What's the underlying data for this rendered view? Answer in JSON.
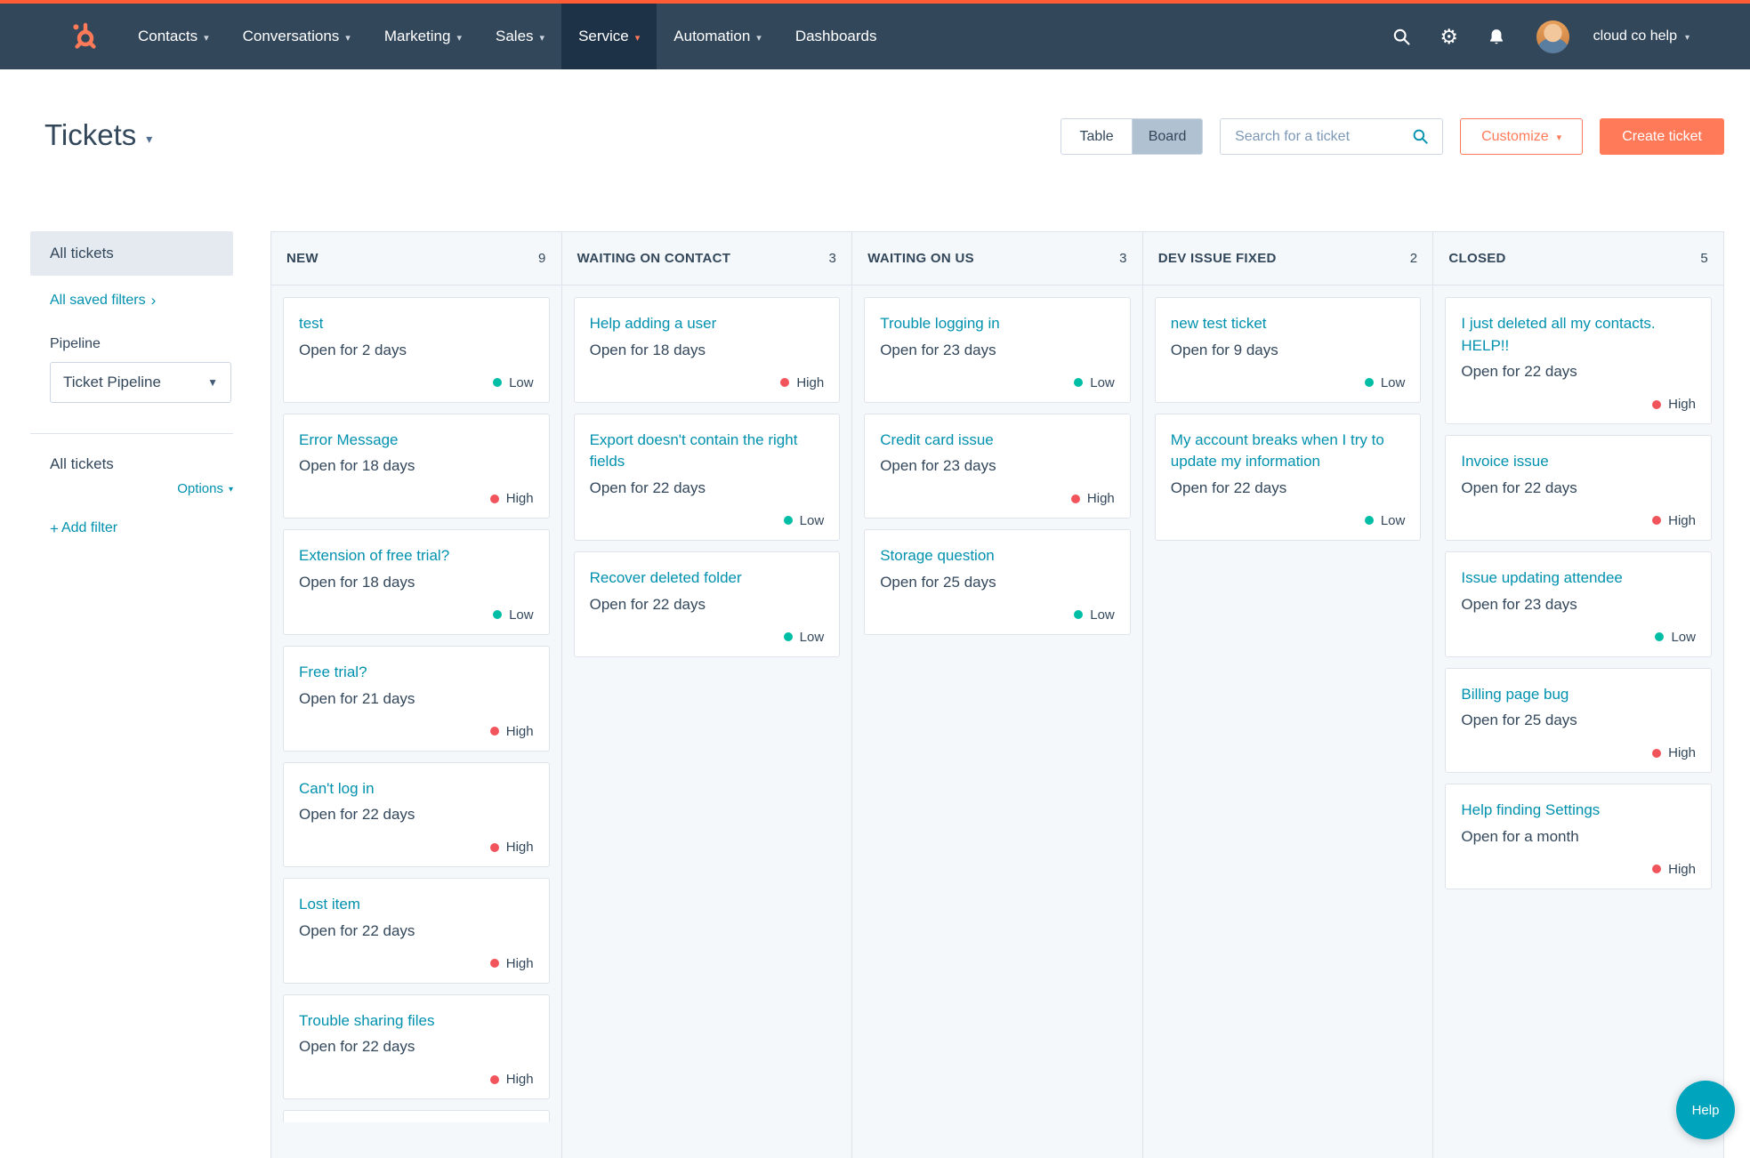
{
  "topbar": {
    "nav": [
      {
        "label": "Contacts",
        "caret": true,
        "active": false
      },
      {
        "label": "Conversations",
        "caret": true,
        "active": false
      },
      {
        "label": "Marketing",
        "caret": true,
        "active": false
      },
      {
        "label": "Sales",
        "caret": true,
        "active": false
      },
      {
        "label": "Service",
        "caret": true,
        "active": true
      },
      {
        "label": "Automation",
        "caret": true,
        "active": false
      },
      {
        "label": "Dashboards",
        "caret": false,
        "active": false
      }
    ],
    "account_name": "cloud co help"
  },
  "header": {
    "title": "Tickets",
    "view_table": "Table",
    "view_board": "Board",
    "selected_view": "Board",
    "search_placeholder": "Search for a ticket",
    "customize_label": "Customize",
    "create_label": "Create ticket"
  },
  "sidebar": {
    "all_tickets": "All tickets",
    "saved_filters": "All saved filters",
    "pipeline_label": "Pipeline",
    "pipeline_value": "Ticket Pipeline",
    "filter_header": "All tickets",
    "options_label": "Options",
    "add_filter_label": "Add filter"
  },
  "board": {
    "columns": [
      {
        "name": "NEW",
        "count": 9,
        "partial": true,
        "cards": [
          {
            "title": "test",
            "open": "Open for 2 days",
            "priority": "Low"
          },
          {
            "title": "Error Message",
            "open": "Open for 18 days",
            "priority": "High"
          },
          {
            "title": "Extension of free trial?",
            "open": "Open for 18 days",
            "priority": "Low"
          },
          {
            "title": "Free trial?",
            "open": "Open for 21 days",
            "priority": "High"
          },
          {
            "title": "Can't log in",
            "open": "Open for 22 days",
            "priority": "High"
          },
          {
            "title": "Lost item",
            "open": "Open for 22 days",
            "priority": "High"
          },
          {
            "title": "Trouble sharing files",
            "open": "Open for 22 days",
            "priority": "High"
          }
        ]
      },
      {
        "name": "WAITING ON CONTACT",
        "count": 3,
        "partial": false,
        "cards": [
          {
            "title": "Help adding a user",
            "open": "Open for 18 days",
            "priority": "High"
          },
          {
            "title": "Export doesn't contain the right fields",
            "open": "Open for 22 days",
            "priority": "Low"
          },
          {
            "title": "Recover deleted folder",
            "open": "Open for 22 days",
            "priority": "Low"
          }
        ]
      },
      {
        "name": "WAITING ON US",
        "count": 3,
        "partial": false,
        "cards": [
          {
            "title": "Trouble logging in",
            "open": "Open for 23 days",
            "priority": "Low"
          },
          {
            "title": "Credit card issue",
            "open": "Open for 23 days",
            "priority": "High"
          },
          {
            "title": "Storage question",
            "open": "Open for 25 days",
            "priority": "Low"
          }
        ]
      },
      {
        "name": "DEV ISSUE FIXED",
        "count": 2,
        "partial": false,
        "cards": [
          {
            "title": "new test ticket",
            "open": "Open for 9 days",
            "priority": "Low"
          },
          {
            "title": "My account breaks when I try to update my information",
            "open": "Open for 22 days",
            "priority": "Low"
          }
        ]
      },
      {
        "name": "CLOSED",
        "count": 5,
        "partial": false,
        "cards": [
          {
            "title": "I just deleted all my contacts. HELP!!",
            "open": "Open for 22 days",
            "priority": "High"
          },
          {
            "title": "Invoice issue",
            "open": "Open for 22 days",
            "priority": "High"
          },
          {
            "title": "Issue updating attendee",
            "open": "Open for 23 days",
            "priority": "Low"
          },
          {
            "title": "Billing page bug",
            "open": "Open for 25 days",
            "priority": "High"
          },
          {
            "title": "Help finding Settings",
            "open": "Open for a month",
            "priority": "High"
          }
        ]
      }
    ]
  },
  "help": {
    "label": "Help"
  },
  "colors": {
    "top_strip": "#ff5c35",
    "navbar": "#33475b",
    "accent_orange": "#ff7a59",
    "link_teal": "#0091ae",
    "text": "#33475b",
    "low_dot": "#00bda5",
    "high_dot": "#f2545b",
    "selected_toggle": "#b0c1d2",
    "sidebar_selected_bg": "#e5eaf0",
    "board_bg": "#f5f8fa",
    "card_border": "#dfe3eb",
    "help_fab": "#00a4bd"
  }
}
